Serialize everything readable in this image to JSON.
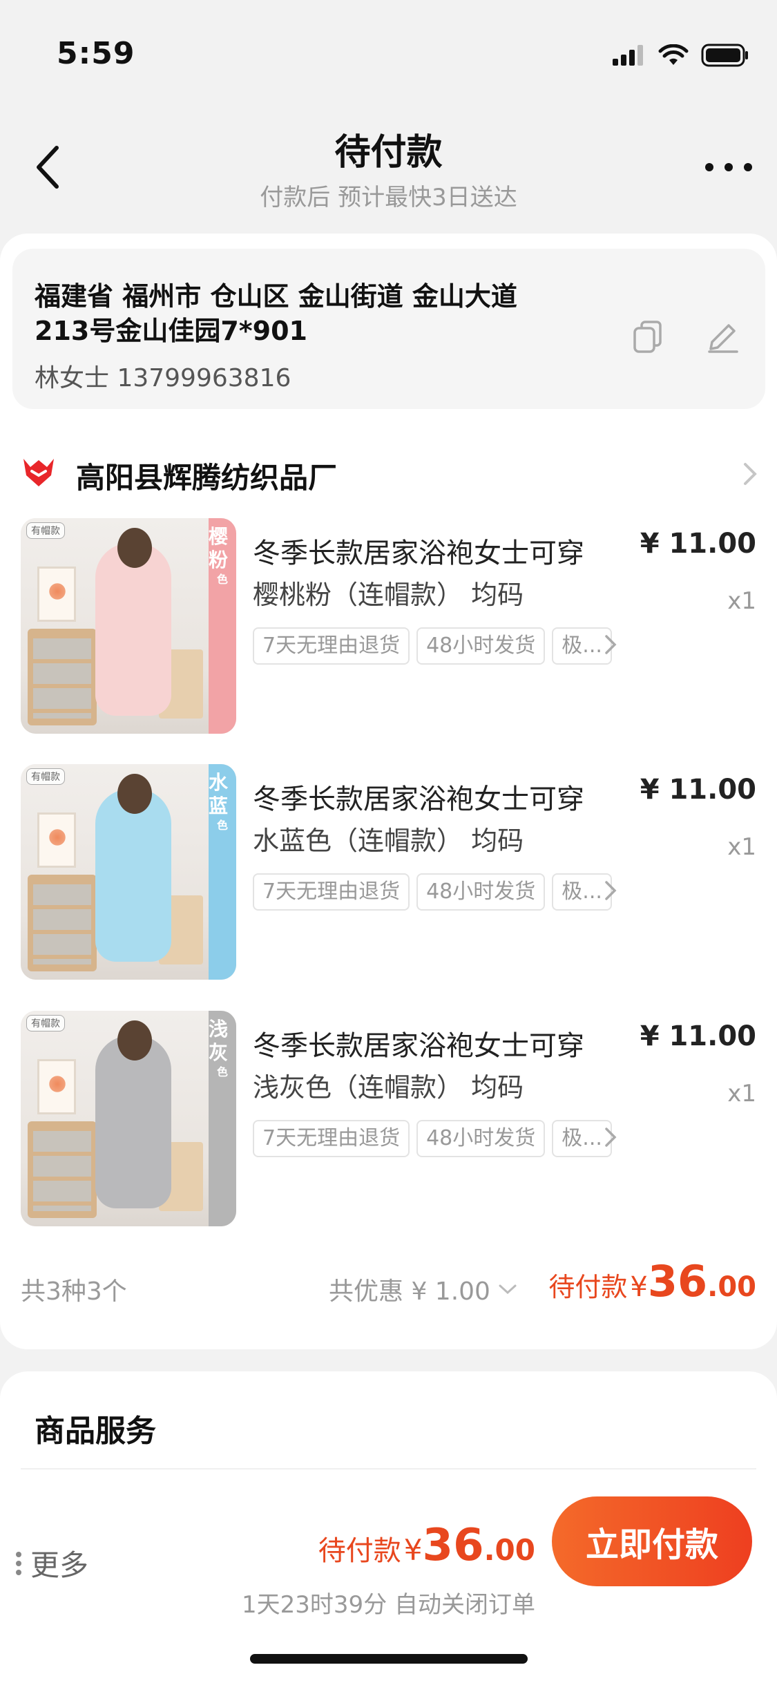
{
  "status_bar": {
    "time": "5:59"
  },
  "nav": {
    "title": "待付款",
    "subtitle": "付款后 预计最快3日送达"
  },
  "address": {
    "line1": "福建省 福州市 仓山区 金山街道 金山大道",
    "line2": "213号金山佳园7*901",
    "contact": "林女士 13799963816"
  },
  "shop": {
    "name": "高阳县辉腾纺织品厂"
  },
  "products": [
    {
      "title": "冬季长款居家浴袍女士可穿",
      "spec": "樱桃粉（连帽款） 均码",
      "price": "¥ 11.00",
      "qty": "x1",
      "tags": [
        "7天无理由退货",
        "48小时发货",
        "极..."
      ],
      "badge": "有帽款",
      "color_label": "樱粉",
      "color_label_sub": "色",
      "color_hex": "#f2a3a6",
      "garment_hex": "#f7d3d2"
    },
    {
      "title": "冬季长款居家浴袍女士可穿",
      "spec": "水蓝色（连帽款） 均码",
      "price": "¥ 11.00",
      "qty": "x1",
      "tags": [
        "7天无理由退货",
        "48小时发货",
        "极..."
      ],
      "badge": "有帽款",
      "color_label": "水蓝",
      "color_label_sub": "色",
      "color_hex": "#8ccdea",
      "garment_hex": "#a9dcef"
    },
    {
      "title": "冬季长款居家浴袍女士可穿",
      "spec": "浅灰色（连帽款） 均码",
      "price": "¥ 11.00",
      "qty": "x1",
      "tags": [
        "7天无理由退货",
        "48小时发货",
        "极..."
      ],
      "badge": "有帽款",
      "color_label": "浅灰",
      "color_label_sub": "色",
      "color_hex": "#b5b5b5",
      "garment_hex": "#b9b9bb"
    }
  ],
  "summary": {
    "count": "共3种3个",
    "discount": "共优惠 ¥ 1.00",
    "pay_label": "待付款",
    "currency": "¥",
    "amount_int": "36",
    "amount_dec": ".00"
  },
  "services": {
    "title": "商品服务"
  },
  "bottom_bar": {
    "more": "更多",
    "pay_label": "待付款",
    "currency": "¥",
    "amount_int": "36",
    "amount_dec": ".00",
    "countdown": "1天23时39分 自动关闭订单",
    "pay_button": "立即付款"
  },
  "colors": {
    "accent": "#e8471e",
    "shop_icon": "#e8262a"
  }
}
